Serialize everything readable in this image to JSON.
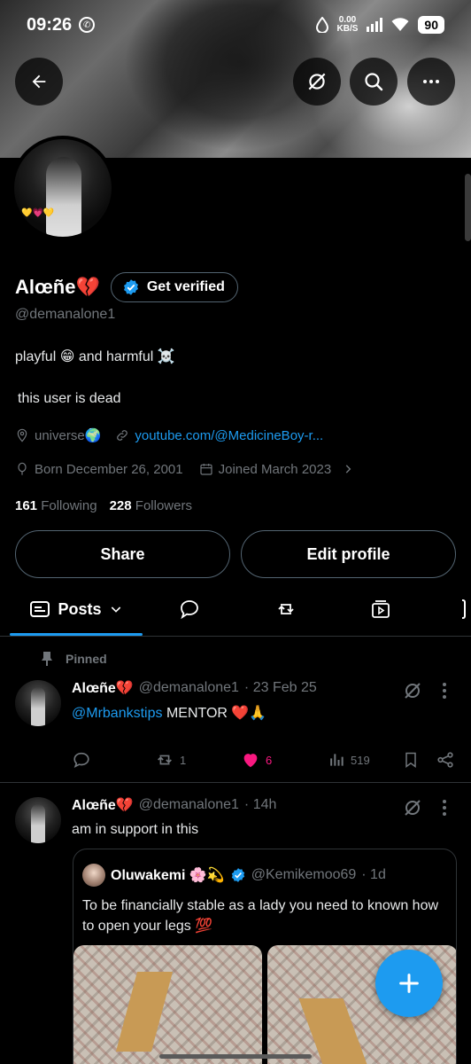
{
  "status_bar": {
    "time": "09:26",
    "net_speed_value": "0.00",
    "net_speed_unit": "KB/S",
    "battery": "90"
  },
  "header": {
    "back_icon": "arrow-left-icon",
    "grok_icon": "grok-icon",
    "search_icon": "search-icon",
    "more_icon": "more-icon"
  },
  "profile": {
    "name": "Alœñe💔",
    "get_verified_label": "Get verified",
    "handle": "@demanalone1",
    "bio_line1": "playful 😁 and harmful ☠️",
    "bio_line2": "this user is dead",
    "location": "universe🌍",
    "website": "youtube.com/@MedicineBoy-r...",
    "birthday": "Born December 26, 2001",
    "joined": "Joined March 2023",
    "following_count": "161",
    "following_label": "Following",
    "followers_count": "228",
    "followers_label": "Followers",
    "share_label": "Share",
    "edit_label": "Edit profile"
  },
  "tabs": {
    "posts_label": "Posts",
    "replies_icon": "speech-bubble-icon",
    "reposts_icon": "repost-icon",
    "media_icon": "media-icon"
  },
  "pinned_label": "Pinned",
  "posts": [
    {
      "name": "Alœñe💔",
      "handle": "@demanalone1",
      "time": "· 23 Feb 25",
      "mention": "@Mrbankstips",
      "text": " MENTOR ❤️🙏",
      "reposts": "1",
      "likes": "6",
      "views": "519"
    },
    {
      "name": "Alœñe💔",
      "handle": "@demanalone1",
      "time": "· 14h",
      "text": "am in support in this",
      "quote": {
        "name": "Oluwakemi 🌸💫",
        "handle": "@Kemikemoo69",
        "time": "· 1d",
        "text": "To be financially stable as a lady you need to known how to open your legs 💯"
      }
    }
  ],
  "colors": {
    "accent": "#1d9bf0",
    "like": "#f91880",
    "secondary_text": "#71767b",
    "border": "#2f3336"
  }
}
